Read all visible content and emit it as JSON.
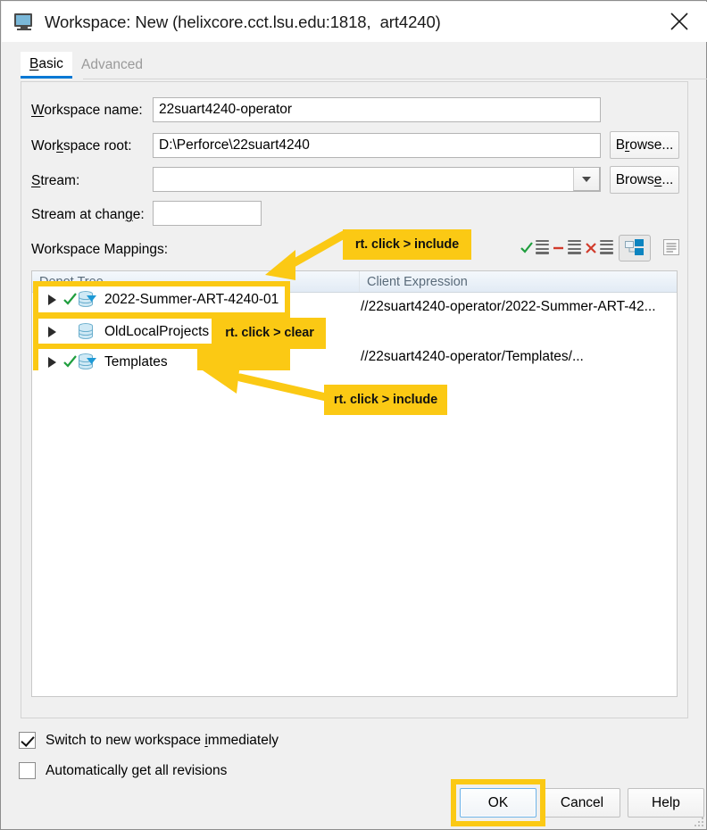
{
  "window": {
    "title": "Workspace: New (helixcore.cct.lsu.edu:1818,  art4240)",
    "icon": "workspace-monitor-icon",
    "close_label": "✕"
  },
  "tabs": [
    {
      "label": "Basic",
      "active": true
    },
    {
      "label": "Advanced",
      "active": false
    }
  ],
  "form": {
    "workspace_name": {
      "label": "Workspace name:",
      "value": "22suart4240-operator"
    },
    "workspace_root": {
      "label": "Workspace root:",
      "value": "D:\\Perforce\\22suart4240",
      "browse_label": "Browse..."
    },
    "stream": {
      "label": "Stream:",
      "value": "",
      "browse_label": "Browse..."
    },
    "stream_at_change": {
      "label": "Stream at change:",
      "value": ""
    },
    "mappings_label": "Workspace Mappings:"
  },
  "map_toolbar": [
    {
      "name": "include-mapping-icon",
      "mark": "check",
      "color": "#1f9e3e"
    },
    {
      "name": "exclude-mapping-icon",
      "mark": "minus",
      "color": "#d13b2c"
    },
    {
      "name": "remove-mapping-icon",
      "mark": "cross",
      "color": "#d13b2c"
    },
    {
      "name": "tree-view-icon",
      "mark": "tree",
      "color": "#0c84c0"
    },
    {
      "name": "text-view-icon",
      "mark": "doc",
      "color": "#9a9a9a"
    }
  ],
  "tree": {
    "columns": [
      "Depot Tree",
      "Client Expression"
    ],
    "rows": [
      {
        "name": "2022-Summer-ART-4240-01",
        "expression": "//22suart4240-operator/2022-Summer-ART-42...",
        "included": true
      },
      {
        "name": "OldLocalProjects",
        "expression": "",
        "included": false
      },
      {
        "name": "Templates",
        "expression": "//22suart4240-operator/Templates/...",
        "included": true
      }
    ]
  },
  "options": [
    {
      "label": "Switch to new workspace immediately",
      "checked": true
    },
    {
      "label": "Automatically get all revisions",
      "checked": false
    }
  ],
  "buttons": {
    "ok": "OK",
    "cancel": "Cancel",
    "help": "Help"
  },
  "annotations": [
    {
      "id": "note-top",
      "text": "rt. click > include"
    },
    {
      "id": "note-middle",
      "text": "rt. click > clear"
    },
    {
      "id": "note-bottom",
      "text": "rt. click > include"
    }
  ],
  "colors": {
    "highlight": "#fbc914",
    "accent": "#0078d4",
    "include_check": "#1f9e3e",
    "depot_icon": "#8ecae6"
  }
}
